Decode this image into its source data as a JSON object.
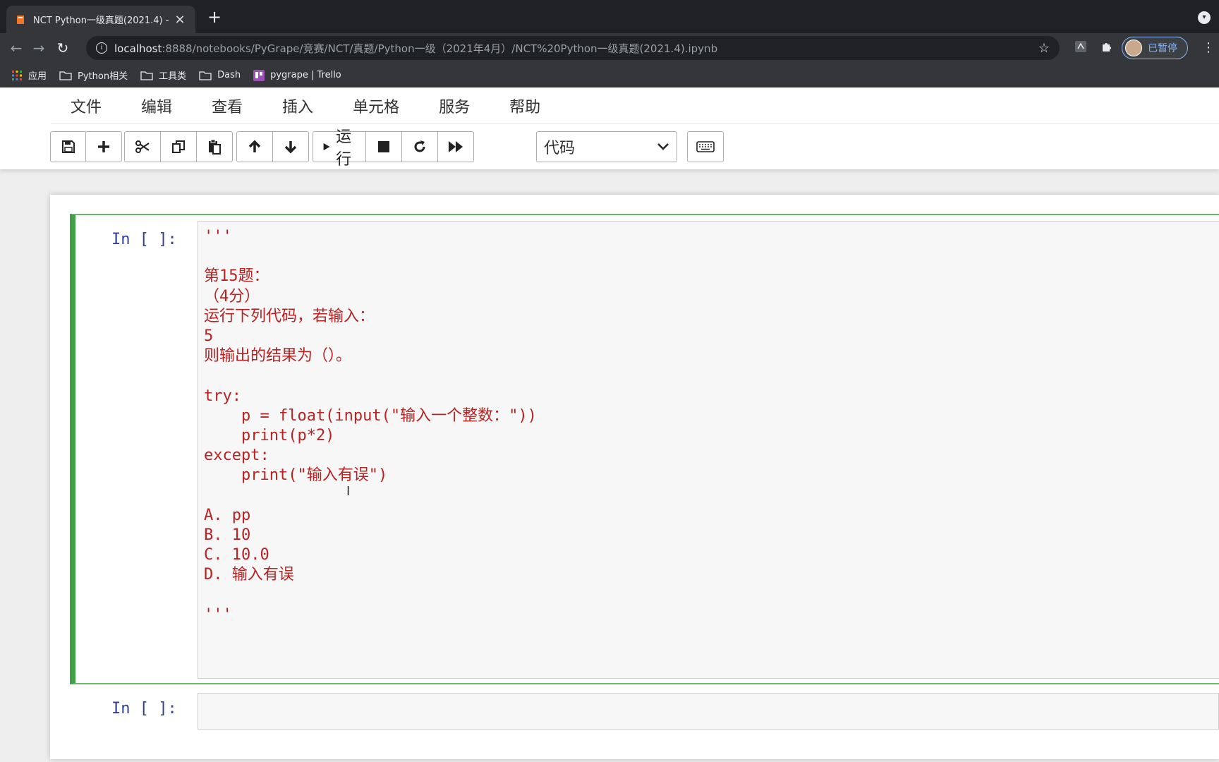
{
  "browser": {
    "tab_title": "NCT Python一级真题(2021.4) -",
    "tab_close": "×",
    "new_tab": "+",
    "url_host": "localhost",
    "url_rest": ":8888/notebooks/PyGrape/竞赛/NCT/真题/Python一级（2021年4月）/NCT%20Python一级真题(2021.4).ipynb",
    "profile_label": "已暂停",
    "bookmarks": [
      {
        "label": "应用",
        "icon": "apps-grid-icon"
      },
      {
        "label": "Python相关",
        "icon": "folder-icon"
      },
      {
        "label": "工具类",
        "icon": "folder-icon"
      },
      {
        "label": "Dash",
        "icon": "folder-icon"
      },
      {
        "label": "pygrape | Trello",
        "icon": "trello-icon"
      }
    ]
  },
  "menu": {
    "items": [
      "文件",
      "编辑",
      "查看",
      "插入",
      "单元格",
      "服务",
      "帮助"
    ]
  },
  "toolbar": {
    "run_label": "运行",
    "cell_type": "代码"
  },
  "cells": [
    {
      "prompt": "In [ ]:",
      "lines": [
        "'''",
        "",
        "第15题：",
        "（4分）",
        "运行下列代码，若输入：",
        "5",
        "则输出的结果为（）。",
        "",
        "try:",
        "    p = float(input(\"输入一个整数：\"))",
        "    print(p*2)",
        "except:",
        "    print(\"输入有误\")",
        "",
        "A. pp",
        "B. 10",
        "C. 10.0",
        "D. 输入有误",
        "",
        "'''"
      ]
    },
    {
      "prompt": "In [ ]:"
    }
  ],
  "colors": {
    "cell_border": "#42a047",
    "string_color": "#ba2121",
    "prompt_color": "#303f9f"
  }
}
